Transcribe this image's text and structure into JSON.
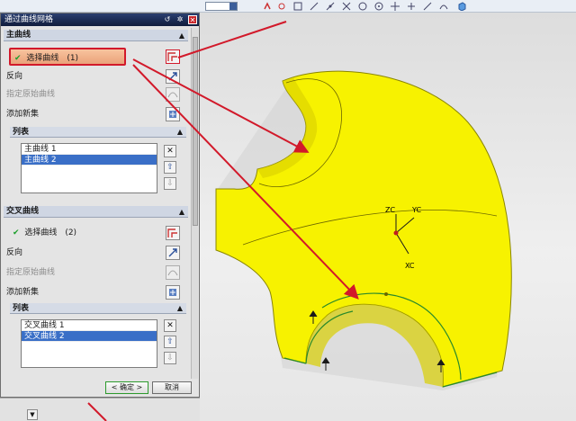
{
  "dialog": {
    "title": "通过曲线网格",
    "primary_section": {
      "header": "主曲线",
      "select_label": "选择曲线",
      "select_count": "(1)",
      "reverse_label": "反向",
      "start_curve_label": "指定原始曲线",
      "add_set_label": "添加新集",
      "list_header": "列表",
      "items": [
        "主曲线 1",
        "主曲线 2"
      ]
    },
    "cross_section": {
      "header": "交叉曲线",
      "select_label": "选择曲线",
      "select_count": "(2)",
      "reverse_label": "反向",
      "start_curve_label": "指定原始曲线",
      "add_set_label": "添加新集",
      "list_header": "列表",
      "items": [
        "交叉曲线 1",
        "交叉曲线 2"
      ]
    },
    "ok_label": "< 确定 >",
    "cancel_label": "取消"
  },
  "viewport": {
    "axes": [
      "ZC",
      "YC",
      "XC"
    ]
  },
  "colors": {
    "surface": "#f7f200",
    "annotation": "#d2192a",
    "selection": "#3a6fc7"
  }
}
